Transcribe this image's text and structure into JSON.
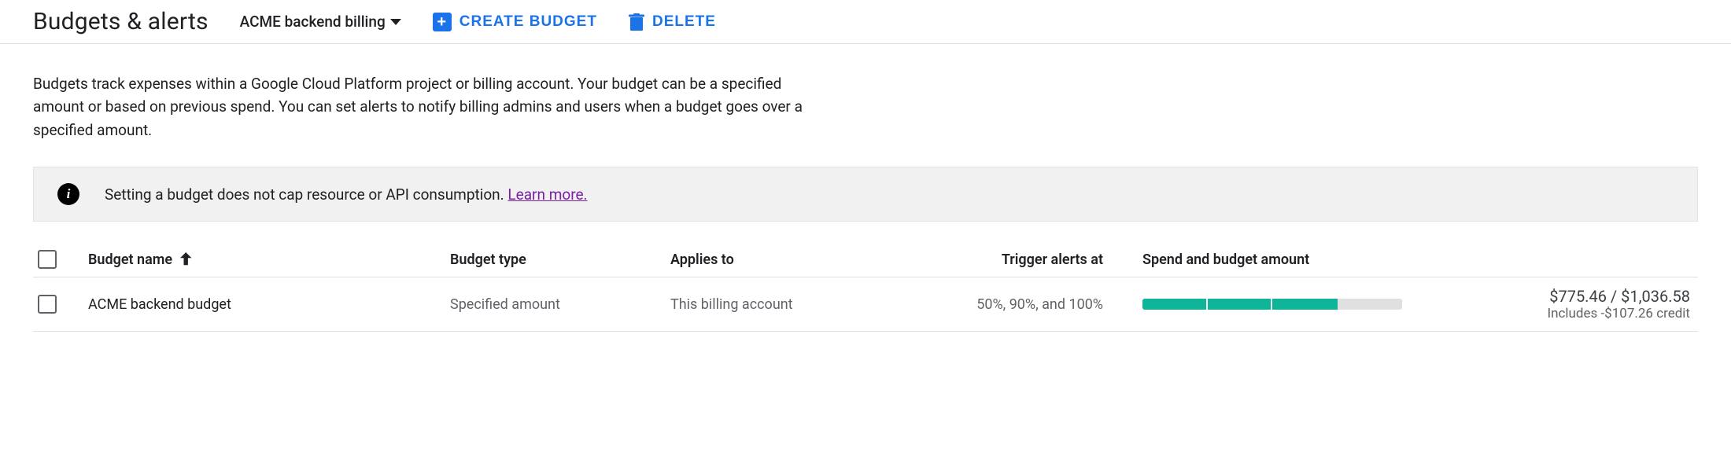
{
  "header": {
    "title": "Budgets & alerts",
    "account": "ACME backend billing",
    "create_label": "Create Budget",
    "delete_label": "Delete"
  },
  "description": "Budgets track expenses within a Google Cloud Platform project or billing account. Your budget can be a specified amount or based on previous spend. You can set alerts to notify billing admins and users when a budget goes over a specified amount.",
  "info_banner": {
    "text": "Setting a budget does not cap resource or API consumption. ",
    "learn_more": "Learn more."
  },
  "table": {
    "headers": {
      "name": "Budget name",
      "type": "Budget type",
      "applies_to": "Applies to",
      "trigger": "Trigger alerts at",
      "spend": "Spend and budget amount"
    },
    "rows": [
      {
        "name": "ACME backend budget",
        "type": "Specified amount",
        "applies_to": "This billing account",
        "trigger": "50%, 90%, and 100%",
        "amount_main": "$775.46 / $1,036.58",
        "amount_sub": "Includes -$107.26 credit",
        "progress_segments_pct": [
          25,
          25,
          25
        ],
        "progress_total_pct": 100
      }
    ]
  }
}
